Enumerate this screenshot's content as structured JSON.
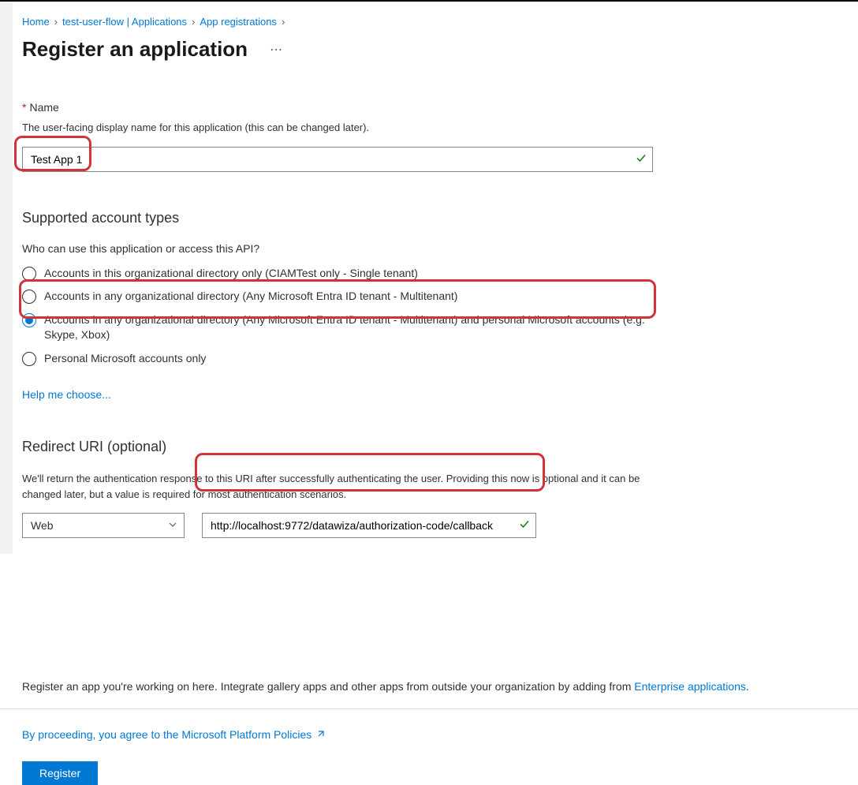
{
  "breadcrumb": {
    "items": [
      "Home",
      "test-user-flow | Applications",
      "App registrations"
    ]
  },
  "page_title": "Register an application",
  "name_section": {
    "label": "Name",
    "hint": "The user-facing display name for this application (this can be changed later).",
    "value": "Test App 1"
  },
  "account_types": {
    "heading": "Supported account types",
    "question": "Who can use this application or access this API?",
    "options": [
      {
        "label": "Accounts in this organizational directory only (CIAMTest only - Single tenant)",
        "checked": false
      },
      {
        "label": "Accounts in any organizational directory (Any Microsoft Entra ID tenant - Multitenant)",
        "checked": false
      },
      {
        "label": "Accounts in any organizational directory (Any Microsoft Entra ID tenant - Multitenant) and personal Microsoft accounts (e.g. Skype, Xbox)",
        "checked": true
      },
      {
        "label": "Personal Microsoft accounts only",
        "checked": false
      }
    ],
    "help_link": "Help me choose..."
  },
  "redirect": {
    "heading": "Redirect URI (optional)",
    "hint": "We'll return the authentication response to this URI after successfully authenticating the user. Providing this now is optional and it can be changed later, but a value is required for most authentication scenarios.",
    "platform": "Web",
    "uri": "http://localhost:9772/datawiza/authorization-code/callback"
  },
  "footer": {
    "text_prefix": "Register an app you're working on here. Integrate gallery apps and other apps from outside your organization by adding from ",
    "link_text": "Enterprise applications",
    "policies_text": "By proceeding, you agree to the Microsoft Platform Policies",
    "register_button": "Register"
  }
}
